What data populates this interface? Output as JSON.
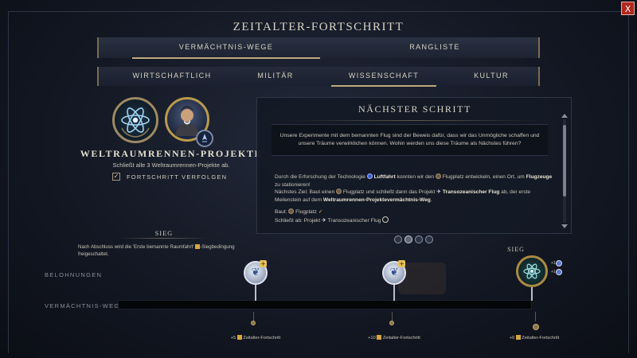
{
  "window": {
    "title": "ZEITALTER-FORTSCHRITT",
    "close_symbol": "X"
  },
  "main_tabs": [
    {
      "label": "VERMÄCHTNIS-WEGE",
      "active": true
    },
    {
      "label": "RANGLISTE",
      "active": false
    }
  ],
  "category_tabs": [
    {
      "label": "WIRTSCHAFTLICH",
      "active": false
    },
    {
      "label": "MILITÄR",
      "active": false
    },
    {
      "label": "WISSENSCHAFT",
      "active": true
    },
    {
      "label": "KULTUR",
      "active": false
    }
  ],
  "project": {
    "title": "WELTRAUMRENNEN-PROJEKTE",
    "subtitle": "Schließt alle 3 Weltraumrennen-Projekte ab.",
    "track_label": "FORTSCHRITT VERFOLGEN",
    "track_checked": true,
    "icons": [
      "atom-icon",
      "portrait-icon"
    ]
  },
  "next_step": {
    "title": "NÄCHSTER SCHRITT",
    "quote": "Unsere Experimente mit dem bemannten Flug sind der Beweis dafür, dass wir das Unmögliche schaffen und unsere Träume verwirklichen können. Wohin werden uns diese Träume als Nächstes führen?",
    "p1_a": "Durch die Erforschung der Technologie",
    "p1_tech": "Luftfahrt",
    "p1_b": "konnten wir den",
    "p1_building": "Flugplatz",
    "p1_c": "entwickeln, einen Ort, um",
    "p1_bold2": "Flugzeuge",
    "p1_d": "zu stationieren!",
    "p2_a": "Nächstes Ziel: Baut einen",
    "p2_building": "Flugplatz",
    "p2_b": "und schließt dann das Projekt",
    "p2_project": "Transozeanischer Flug",
    "p2_c": "ab, der erste Meilenstein auf dem",
    "p2_bold": "Weltraumrennen-Projektevermächtnis-Weg",
    "p2_d": ".",
    "req1_label": "Baut:",
    "req1_item": "Flugplatz",
    "req2_label": "Schließt ab: Projekt",
    "req2_item": "Transozeanischer Flug"
  },
  "page_dots": [
    false,
    true,
    false,
    false
  ],
  "victory_left": {
    "label": "SIEG",
    "note_a": "Nach Abschluss wird die 'Erste bemannte Raumfahrt'",
    "note_b": "-Siegbedingung freigeschaltet."
  },
  "rows": {
    "rewards_label": "BELOHNUNGEN",
    "legacy_label": "VERMÄCHTNIS-WEGE"
  },
  "victory_right": {
    "label": "SIEG",
    "badge_a": "+1",
    "badge_b": "+1"
  },
  "era_rewards": [
    {
      "text": "+5",
      "label": "Zeitalter-Fortschritt"
    },
    {
      "text": "+10",
      "label": "Zeitalter-Fortschritt"
    },
    {
      "text": "+0",
      "label": "Zeitalter-Fortschritt"
    }
  ],
  "colors": {
    "accent_gold": "#bda97d",
    "close_red": "#b3261e",
    "reward_blue": "#34558e"
  }
}
